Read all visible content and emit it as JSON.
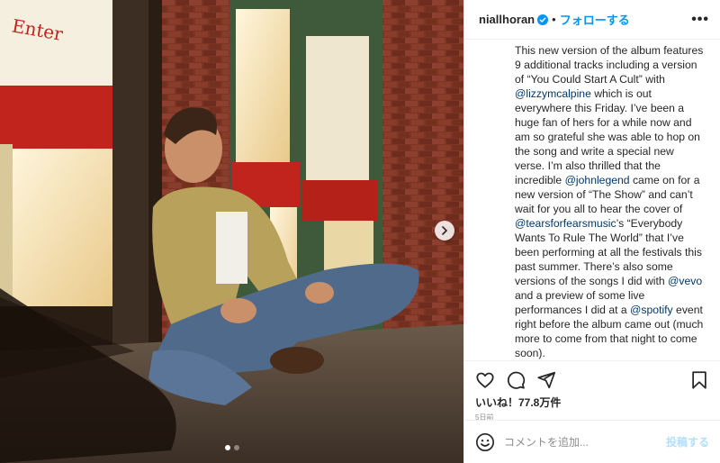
{
  "header": {
    "username": "niallhoran",
    "separator": "•",
    "follow_label": "フォローする",
    "more_label": "•••"
  },
  "caption": {
    "segments": [
      {
        "text": "This new version of the album features 9 additional tracks including a version of “You Could Start A Cult” with ",
        "type": "text"
      },
      {
        "text": "@lizzymcalpine",
        "type": "mention"
      },
      {
        "text": " which is out everywhere this Friday. I’ve been a huge fan of hers for a while now and am so grateful she was able to hop on the song and write a special new verse. I’m also thrilled that the incredible ",
        "type": "text"
      },
      {
        "text": "@johnlegend",
        "type": "mention"
      },
      {
        "text": " came on for a new version of “The Show” and can’t wait for you all to hear the cover of ",
        "type": "text"
      },
      {
        "text": "@tearsforfearsmusic",
        "type": "mention"
      },
      {
        "text": "’s “Everybody Wants To Rule The World” that I’ve been performing at all the festivals this past summer. There’s also some versions of the songs I did with ",
        "type": "text"
      },
      {
        "text": "@vevo",
        "type": "mention"
      },
      {
        "text": " and a preview of some live performances I did at a ",
        "type": "text"
      },
      {
        "text": "@spotify",
        "type": "mention"
      },
      {
        "text": " event right before the album came out (much more to come from that night to come soon).",
        "type": "text"
      }
    ]
  },
  "stats": {
    "likes": "いいね！77.8万件",
    "date": "5日前"
  },
  "comment": {
    "placeholder": "コメントを追加...",
    "post_label": "投稿する"
  },
  "carousel": {
    "total": 2,
    "active": 0
  },
  "colors": {
    "accent": "#0095f6",
    "mention": "#00376b",
    "post_disabled": "#b2dffc",
    "verified": "#0095f6"
  },
  "icons": {
    "verified": "verified-badge-icon",
    "next": "chevron-right-icon",
    "like": "heart-icon",
    "comment": "comment-icon",
    "share": "paper-plane-icon",
    "save": "bookmark-icon",
    "emoji": "smiley-icon"
  }
}
